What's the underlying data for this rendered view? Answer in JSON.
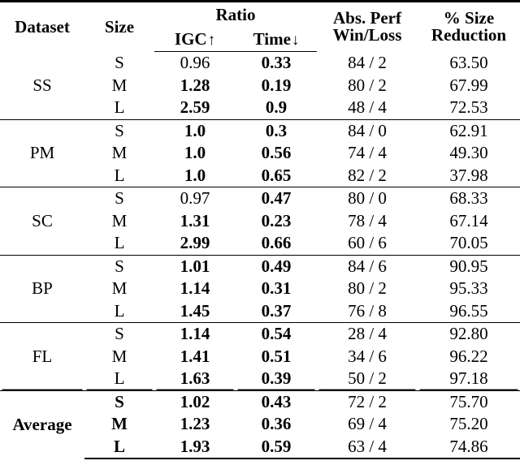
{
  "table": {
    "columns": {
      "dataset": "Dataset",
      "size": "Size",
      "ratio_group": "Ratio",
      "igc": "IGC",
      "igc_arrow": "↑",
      "time": "Time",
      "time_arrow": "↓",
      "abs_perf_line1": "Abs. Perf",
      "abs_perf_line2": "Win/Loss",
      "reduction_line1": "% Size",
      "reduction_line2": "Reduction"
    },
    "blocks": [
      {
        "dataset": "SS",
        "dataset_bold": false,
        "rows": [
          {
            "size": "S",
            "size_bold": false,
            "igc": "0.96",
            "igc_bold": false,
            "time": "0.33",
            "time_bold": true,
            "perf": "84 / 2",
            "reduction": "63.50"
          },
          {
            "size": "M",
            "size_bold": false,
            "igc": "1.28",
            "igc_bold": true,
            "time": "0.19",
            "time_bold": true,
            "perf": "80 / 2",
            "reduction": "67.99"
          },
          {
            "size": "L",
            "size_bold": false,
            "igc": "2.59",
            "igc_bold": true,
            "time": "0.9",
            "time_bold": true,
            "perf": "48 / 4",
            "reduction": "72.53"
          }
        ]
      },
      {
        "dataset": "PM",
        "dataset_bold": false,
        "rows": [
          {
            "size": "S",
            "size_bold": false,
            "igc": "1.0",
            "igc_bold": true,
            "time": "0.3",
            "time_bold": true,
            "perf": "84 / 0",
            "reduction": "62.91"
          },
          {
            "size": "M",
            "size_bold": false,
            "igc": "1.0",
            "igc_bold": true,
            "time": "0.56",
            "time_bold": true,
            "perf": "74 / 4",
            "reduction": "49.30"
          },
          {
            "size": "L",
            "size_bold": false,
            "igc": "1.0",
            "igc_bold": true,
            "time": "0.65",
            "time_bold": true,
            "perf": "82 / 2",
            "reduction": "37.98"
          }
        ]
      },
      {
        "dataset": "SC",
        "dataset_bold": false,
        "rows": [
          {
            "size": "S",
            "size_bold": false,
            "igc": "0.97",
            "igc_bold": false,
            "time": "0.47",
            "time_bold": true,
            "perf": "80 / 0",
            "reduction": "68.33"
          },
          {
            "size": "M",
            "size_bold": false,
            "igc": "1.31",
            "igc_bold": true,
            "time": "0.23",
            "time_bold": true,
            "perf": "78 / 4",
            "reduction": "67.14"
          },
          {
            "size": "L",
            "size_bold": false,
            "igc": "2.99",
            "igc_bold": true,
            "time": "0.66",
            "time_bold": true,
            "perf": "60 / 6",
            "reduction": "70.05"
          }
        ]
      },
      {
        "dataset": "BP",
        "dataset_bold": false,
        "rows": [
          {
            "size": "S",
            "size_bold": false,
            "igc": "1.01",
            "igc_bold": true,
            "time": "0.49",
            "time_bold": true,
            "perf": "84 / 6",
            "reduction": "90.95"
          },
          {
            "size": "M",
            "size_bold": false,
            "igc": "1.14",
            "igc_bold": true,
            "time": "0.31",
            "time_bold": true,
            "perf": "80 / 2",
            "reduction": "95.33"
          },
          {
            "size": "L",
            "size_bold": false,
            "igc": "1.45",
            "igc_bold": true,
            "time": "0.37",
            "time_bold": true,
            "perf": "76 / 8",
            "reduction": "96.55"
          }
        ]
      },
      {
        "dataset": "FL",
        "dataset_bold": false,
        "rows": [
          {
            "size": "S",
            "size_bold": false,
            "igc": "1.14",
            "igc_bold": true,
            "time": "0.54",
            "time_bold": true,
            "perf": "28 / 4",
            "reduction": "92.80"
          },
          {
            "size": "M",
            "size_bold": false,
            "igc": "1.41",
            "igc_bold": true,
            "time": "0.51",
            "time_bold": true,
            "perf": "34 / 6",
            "reduction": "96.22"
          },
          {
            "size": "L",
            "size_bold": false,
            "igc": "1.63",
            "igc_bold": true,
            "time": "0.39",
            "time_bold": true,
            "perf": "50 / 2",
            "reduction": "97.18"
          }
        ]
      },
      {
        "dataset": "Average",
        "dataset_bold": true,
        "double_rule": true,
        "rows": [
          {
            "size": "S",
            "size_bold": true,
            "igc": "1.02",
            "igc_bold": true,
            "time": "0.43",
            "time_bold": true,
            "perf": "72 / 2",
            "reduction": "75.70"
          },
          {
            "size": "M",
            "size_bold": true,
            "igc": "1.23",
            "igc_bold": true,
            "time": "0.36",
            "time_bold": true,
            "perf": "69 / 4",
            "reduction": "75.20"
          },
          {
            "size": "L",
            "size_bold": true,
            "igc": "1.93",
            "igc_bold": true,
            "time": "0.59",
            "time_bold": true,
            "perf": "63 / 4",
            "reduction": "74.86"
          }
        ]
      }
    ]
  }
}
